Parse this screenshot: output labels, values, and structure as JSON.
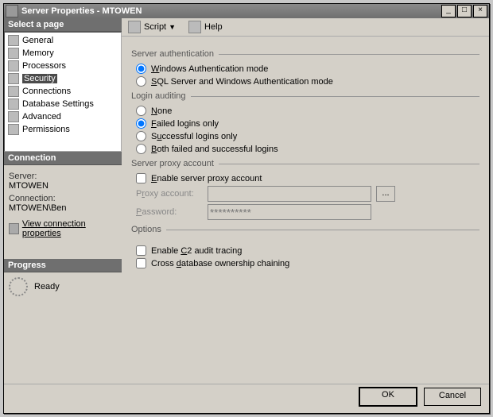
{
  "title": "Server Properties - MTOWEN",
  "winbuttons": {
    "min": "_",
    "max": "□",
    "close": "×"
  },
  "left": {
    "select_header": "Select a page",
    "pages": [
      "General",
      "Memory",
      "Processors",
      "Security",
      "Connections",
      "Database Settings",
      "Advanced",
      "Permissions"
    ],
    "selected_index": 3,
    "connection_header": "Connection",
    "server_label": "Server:",
    "server_value": "MTOWEN",
    "conn_label": "Connection:",
    "conn_value": "MTOWEN\\Ben",
    "view_props": "View connection properties",
    "progress_header": "Progress",
    "progress_status": "Ready"
  },
  "toolbar": {
    "script": "Script",
    "help": "Help"
  },
  "sections": {
    "server_auth": {
      "title": "Server authentication",
      "opt1": "Windows Authentication mode",
      "opt2": "SQL Server and Windows Authentication mode",
      "selected": 0
    },
    "login_audit": {
      "title": "Login auditing",
      "opts": [
        "None",
        "Failed logins only",
        "Successful logins only",
        "Both failed and successful logins"
      ],
      "selected": 1
    },
    "proxy": {
      "title": "Server proxy account",
      "enable": "Enable server proxy account",
      "account_label": "Proxy account:",
      "password_label": "Password:",
      "password_mask": "**********"
    },
    "options": {
      "title": "Options",
      "c2": "Enable C2 audit tracing",
      "cross": "Cross database ownership chaining"
    }
  },
  "buttons": {
    "ok": "OK",
    "cancel": "Cancel"
  }
}
